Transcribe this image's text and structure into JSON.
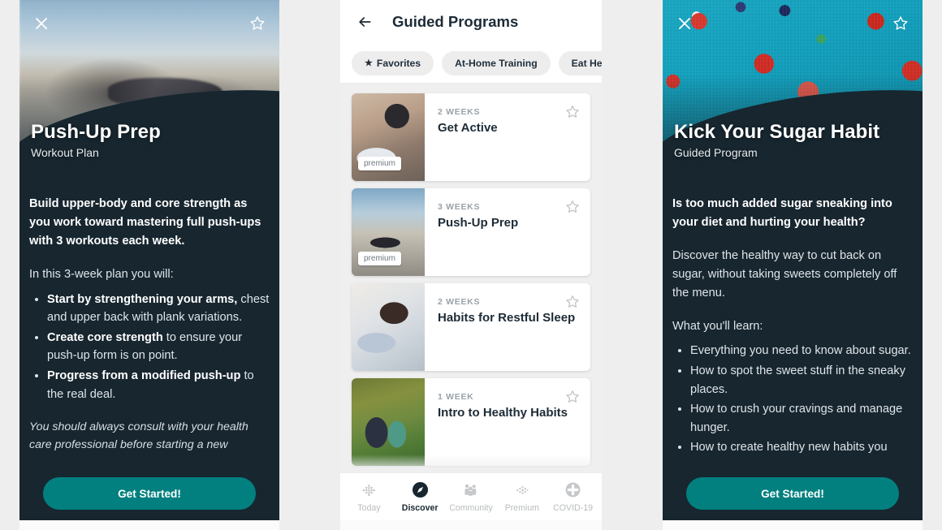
{
  "colors": {
    "dark_navy": "#17262F",
    "teal_accent": "#02807F",
    "page_background": "#EFEEEE",
    "card_white": "#FFFFFF",
    "chip_gray": "#EEEDED"
  },
  "left_panel": {
    "close_icon": "close-icon",
    "favorite_icon": "star-outline-icon",
    "hero": {
      "title": "Push-Up Prep",
      "subtitle": "Workout Plan",
      "image": "man-doing-push-ups-on-outdoor-bleachers"
    },
    "lede": "Build upper-body and core strength as you work toward mastering full push-ups with 3 workouts each week.",
    "intro": "In this 3-week plan you will:",
    "bullets": [
      {
        "bold": "Start by strengthening your arms,",
        "rest": " chest and upper back with plank variations."
      },
      {
        "bold": "Create core strength",
        "rest": " to ensure your push-up form is on point."
      },
      {
        "bold": "Progress from a modified push-up",
        "rest": " to the real deal."
      }
    ],
    "disclaimer": "You should always consult with your health care professional before starting a new",
    "cta_label": "Get Started!"
  },
  "mid_panel": {
    "appbar": {
      "back_icon": "arrow-left-icon",
      "title": "Guided Programs"
    },
    "chips": [
      {
        "label": "Favorites",
        "icon": "star-filled-icon",
        "has_icon": true
      },
      {
        "label": "At-Home Training",
        "has_icon": false
      },
      {
        "label": "Eat Healthy",
        "has_icon": false
      },
      {
        "label": "",
        "has_icon": false
      }
    ],
    "cards": [
      {
        "duration": "2 WEEKS",
        "title": "Get Active",
        "premium_label": "premium",
        "premium": true,
        "thumb": "tying-running-shoe",
        "star_icon": "star-outline-icon"
      },
      {
        "duration": "3 WEEKS",
        "title": "Push-Up Prep",
        "premium_label": "premium",
        "premium": true,
        "thumb": "outdoor-push-up",
        "star_icon": "star-outline-icon"
      },
      {
        "duration": "2 WEEKS",
        "title": "Habits for Restful Sleep",
        "premium_label": "",
        "premium": false,
        "thumb": "woman-sleeping-in-bed",
        "star_icon": "star-outline-icon"
      },
      {
        "duration": "1 WEEK",
        "title": "Intro to Healthy Habits",
        "premium_label": "",
        "premium": false,
        "thumb": "couple-walking-in-park",
        "star_icon": "star-outline-icon"
      }
    ],
    "tabs": [
      {
        "label": "Today",
        "icon": "dot-grid-icon",
        "active": false
      },
      {
        "label": "Discover",
        "icon": "compass-icon",
        "active": true
      },
      {
        "label": "Community",
        "icon": "people-icon",
        "active": false
      },
      {
        "label": "Premium",
        "icon": "sparkle-dot-icon",
        "active": false
      },
      {
        "label": "COVID-19",
        "icon": "medical-plus-icon",
        "active": false
      }
    ]
  },
  "right_panel": {
    "close_icon": "close-icon",
    "favorite_icon": "star-outline-icon",
    "hero": {
      "title": "Kick Your Sugar Habit",
      "subtitle": "Guided Program",
      "image": "strawberries-and-blueberries-on-teal-cloth"
    },
    "lede": "Is too much added sugar sneaking into your diet and hurting your health?",
    "para": "Discover the healthy way to cut back on sugar, without taking sweets completely off the menu.",
    "intro": "What you'll learn:",
    "bullets": [
      {
        "bold": "",
        "rest": "Everything you need to know about sugar."
      },
      {
        "bold": "",
        "rest": "How to spot the sweet stuff in the sneaky places."
      },
      {
        "bold": "",
        "rest": "How to crush your cravings and manage hunger."
      },
      {
        "bold": "",
        "rest": "How to create healthy new habits you"
      }
    ],
    "cta_label": "Get Started!"
  }
}
